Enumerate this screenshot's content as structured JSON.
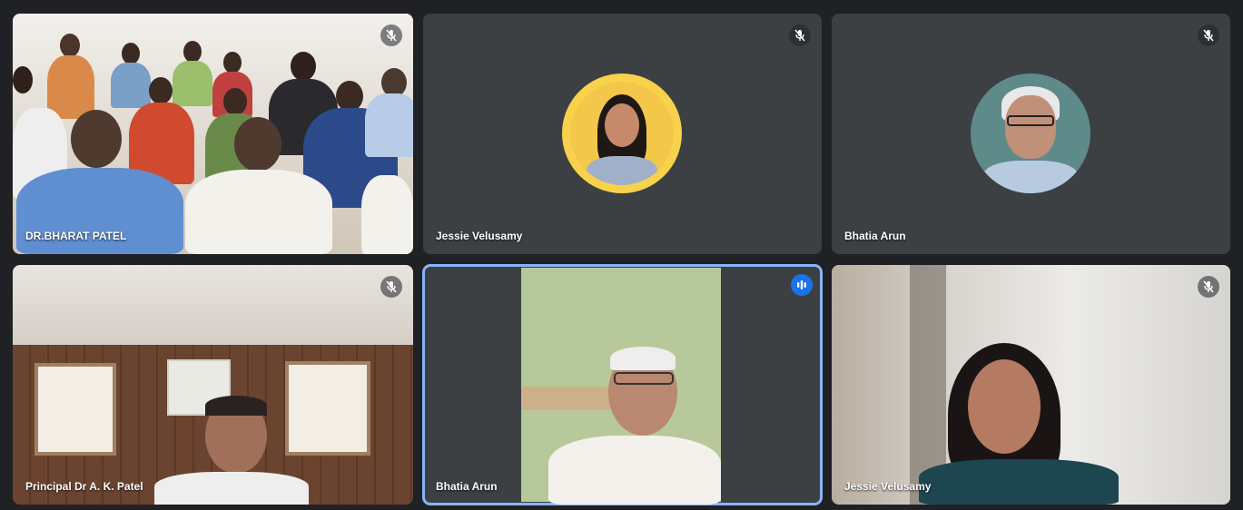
{
  "participants": [
    {
      "name": "DR.BHARAT PATEL",
      "muted": true,
      "icon": "mic-off-icon"
    },
    {
      "name": "Jessie Velusamy",
      "muted": true,
      "icon": "mic-off-icon",
      "avatar_ring": "#f9d24b"
    },
    {
      "name": "Bhatia Arun",
      "muted": true,
      "icon": "mic-off-icon"
    },
    {
      "name": "Principal Dr A. K. Patel",
      "muted": true,
      "icon": "mic-off-icon"
    },
    {
      "name": "Bhatia Arun",
      "muted": false,
      "speaking": true,
      "icon": "audio-level-icon"
    },
    {
      "name": "Jessie Velusamy",
      "muted": true,
      "icon": "mic-off-icon"
    }
  ],
  "colors": {
    "background": "#202124",
    "tile": "#3c4043",
    "active_border": "#8ab4f8",
    "speaking_badge": "#1a73e8"
  }
}
